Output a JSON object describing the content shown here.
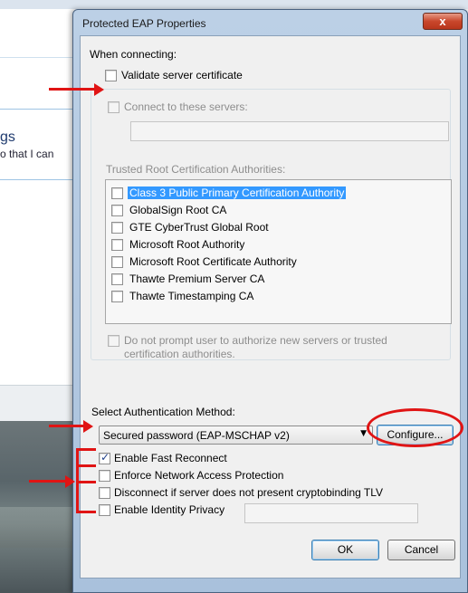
{
  "background_window": {
    "heading": "gs",
    "subtext": "o that I can"
  },
  "dialog": {
    "title": "Protected EAP Properties",
    "close_label": "x",
    "when_connecting_label": "When connecting:",
    "validate_cert": {
      "label": "Validate server certificate",
      "checked": false
    },
    "connect_servers": {
      "label": "Connect to these servers:",
      "checked": false,
      "value": ""
    },
    "trusted_root_label": "Trusted Root Certification Authorities:",
    "ca_list": [
      {
        "label": "Class 3 Public Primary Certification Authority",
        "checked": false,
        "selected": true
      },
      {
        "label": "GlobalSign Root CA",
        "checked": false,
        "selected": false
      },
      {
        "label": "GTE CyberTrust Global Root",
        "checked": false,
        "selected": false
      },
      {
        "label": "Microsoft Root Authority",
        "checked": false,
        "selected": false
      },
      {
        "label": "Microsoft Root Certificate Authority",
        "checked": false,
        "selected": false
      },
      {
        "label": "Thawte Premium Server CA",
        "checked": false,
        "selected": false
      },
      {
        "label": "Thawte Timestamping CA",
        "checked": false,
        "selected": false
      }
    ],
    "do_not_prompt": {
      "line1": "Do not prompt user to authorize new servers or trusted",
      "line2": "certification authorities.",
      "checked": false
    },
    "auth_method_label": "Select Authentication Method:",
    "auth_method_value": "Secured password (EAP-MSCHAP v2)",
    "configure_label": "Configure...",
    "options": {
      "fast_reconnect": {
        "label": "Enable Fast Reconnect",
        "checked": true
      },
      "nap": {
        "label": "Enforce Network Access Protection",
        "checked": false
      },
      "cryptobinding": {
        "label": "Disconnect if server does not present cryptobinding TLV",
        "checked": false
      },
      "identity_privacy": {
        "label": "Enable Identity Privacy",
        "checked": false,
        "value": ""
      }
    },
    "ok_label": "OK",
    "cancel_label": "Cancel"
  },
  "colors": {
    "annotation": "#e01414",
    "selection": "#3399ff",
    "title_bar": "#bcd0e6",
    "close_button": "#c9472c"
  }
}
